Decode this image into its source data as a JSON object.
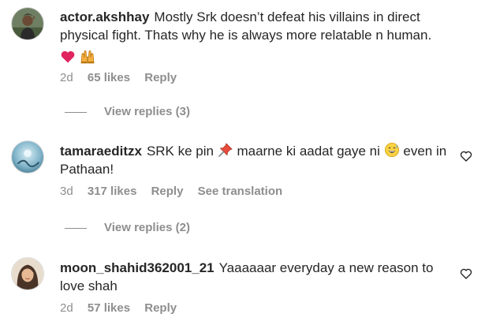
{
  "comments": [
    {
      "username": "actor.akshhay",
      "text": "Mostly Srk doesn’t defeat his villains in direct physical fight. Thats why he is always more relatable n human.",
      "emojis": [
        "red-heart-icon",
        "raised-hands-icon"
      ],
      "time": "2d",
      "likes": "65 likes",
      "reply": "Reply",
      "view_replies": "View replies (3)"
    },
    {
      "username": "tamaraeditzx",
      "text_before": "SRK ke pin",
      "emoji1": "pushpin-icon",
      "text_middle": "maarne ki aadat gaye ni",
      "emoji2": "grinning-sweat-face-icon",
      "text_after": "even in Pathaan!",
      "time": "3d",
      "likes": "317 likes",
      "reply": "Reply",
      "see_translation": "See translation",
      "view_replies": "View replies (2)"
    },
    {
      "username": "moon_shahid362001_21",
      "text": "Yaaaaaar everyday a new reason to love shah",
      "time": "2d",
      "likes": "57 likes",
      "reply": "Reply"
    }
  ],
  "colors": {
    "text": "#262626",
    "secondary": "#8e8e8e",
    "heart": "#e0245e"
  }
}
